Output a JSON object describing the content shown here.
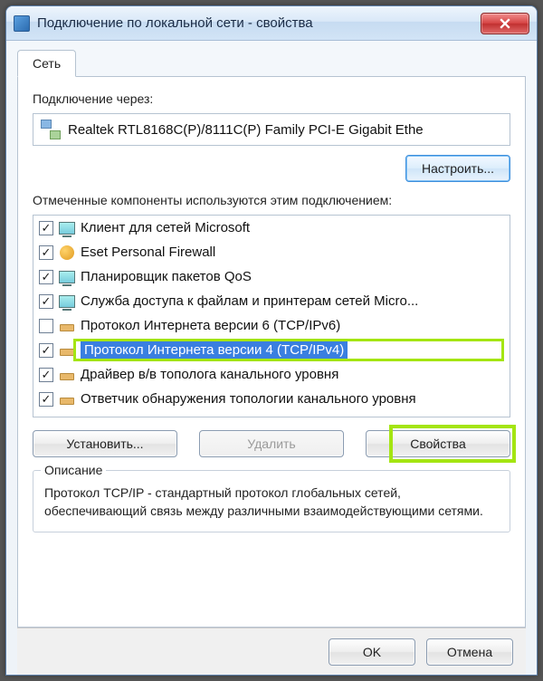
{
  "title": "Подключение по локальной сети - свойства",
  "tab_label": "Сеть",
  "connect_via_label": "Подключение через:",
  "adapter_name": "Realtek RTL8168C(P)/8111C(P) Family PCI-E Gigabit Ethe",
  "configure_btn": "Настроить...",
  "components_label": "Отмеченные компоненты используются этим подключением:",
  "components": [
    {
      "checked": true,
      "icon": "monitor",
      "label": "Клиент для сетей Microsoft"
    },
    {
      "checked": true,
      "icon": "fw",
      "label": "Eset Personal Firewall"
    },
    {
      "checked": true,
      "icon": "monitor",
      "label": "Планировщик пакетов QoS"
    },
    {
      "checked": true,
      "icon": "monitor",
      "label": "Служба доступа к файлам и принтерам сетей Micro..."
    },
    {
      "checked": false,
      "icon": "proto",
      "label": "Протокол Интернета версии 6 (TCP/IPv6)"
    },
    {
      "checked": true,
      "icon": "proto",
      "label": "Протокол Интернета версии 4 (TCP/IPv4)",
      "selected": true
    },
    {
      "checked": true,
      "icon": "proto",
      "label": "Драйвер в/в тополога канального уровня"
    },
    {
      "checked": true,
      "icon": "proto",
      "label": "Ответчик обнаружения топологии канального уровня"
    }
  ],
  "install_btn": "Установить...",
  "remove_btn": "Удалить",
  "properties_btn": "Свойства",
  "description_legend": "Описание",
  "description_text": "Протокол TCP/IP - стандартный протокол глобальных сетей, обеспечивающий связь между различными взаимодействующими сетями.",
  "ok_btn": "OK",
  "cancel_btn": "Отмена"
}
